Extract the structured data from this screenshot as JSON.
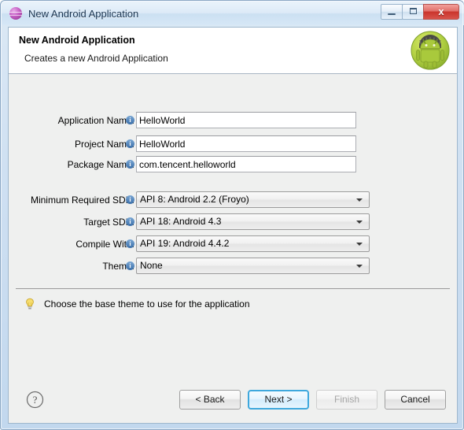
{
  "window": {
    "title": "New Android Application",
    "icon": "eclipse-sphere-icon",
    "controls": {
      "minimize": "minimize-icon",
      "maximize": "maximize-icon",
      "close_label": "x"
    }
  },
  "header": {
    "title": "New Android Application",
    "subtitle": "Creates a new Android Application",
    "logo": "android-robot-icon"
  },
  "form": {
    "info_icon_char": "i",
    "text_fields": [
      {
        "label": "Application Name:",
        "value": "HelloWorld",
        "placeholder": ""
      },
      {
        "label": "Project Name:",
        "value": "HelloWorld",
        "placeholder": ""
      },
      {
        "label": "Package Name:",
        "value": "com.tencent.helloworld",
        "placeholder": ""
      }
    ],
    "combos": [
      {
        "label": "Minimum Required SDK:",
        "value": "API 8: Android 2.2 (Froyo)"
      },
      {
        "label": "Target SDK:",
        "value": "API 18: Android 4.3"
      },
      {
        "label": "Compile With:",
        "value": "API 19: Android 4.4.2"
      },
      {
        "label": "Theme:",
        "value": "None"
      }
    ]
  },
  "hint": {
    "icon": "lightbulb-icon",
    "text": "Choose the base theme to use for the application"
  },
  "footer": {
    "help_icon": "help-question-icon",
    "buttons": [
      {
        "label": "< Back",
        "state": "normal"
      },
      {
        "label": "Next >",
        "state": "focused"
      },
      {
        "label": "Finish",
        "state": "disabled"
      },
      {
        "label": "Cancel",
        "state": "normal"
      }
    ]
  },
  "colors": {
    "accent": "#3ea8dd",
    "android_green": "#a4c639",
    "close_red": "#c9342c",
    "dialog_bg": "#eff0ef",
    "title_bg": "#dceaf7"
  }
}
